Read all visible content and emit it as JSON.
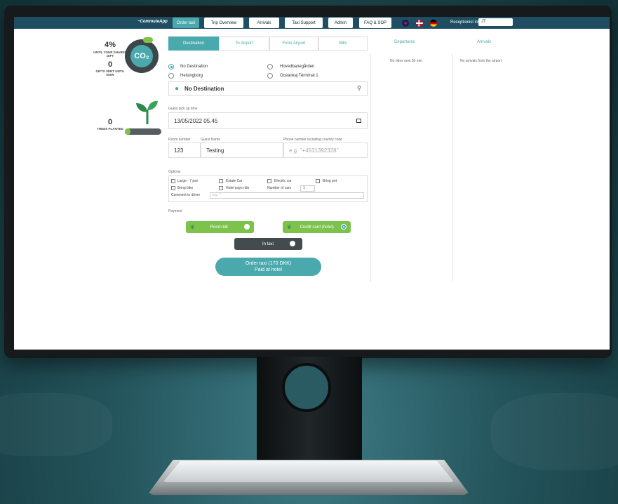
{
  "app": {
    "brand": "~CommuteApp"
  },
  "nav": {
    "tabs": [
      {
        "label": "Order taxi",
        "active": true
      },
      {
        "label": "Trip Overview"
      },
      {
        "label": "Arrivals"
      },
      {
        "label": "Taxi Support"
      },
      {
        "label": "Admin"
      },
      {
        "label": "FAQ & SOP"
      }
    ],
    "flags": [
      "uk-flag-icon",
      "denmark-flag-icon",
      "germany-flag-icon"
    ],
    "receptionist_label": "Receptionist initials",
    "receptionist_value": "JT"
  },
  "stats": {
    "shared_pct": "4%",
    "shared_label": "UNTIL YOUR SHARED GIFT",
    "gifts_count": "0",
    "gifts_label": "GIFTS SENT UNTIL NOW",
    "co2_label": "CO₂",
    "trees_count": "0",
    "trees_label": "TREES PLANTED"
  },
  "form": {
    "subtabs": [
      {
        "label": "Destination",
        "active": true
      },
      {
        "label": "To Airport"
      },
      {
        "label": "From Airport"
      },
      {
        "label": "Bills"
      }
    ],
    "destinations": [
      {
        "label": "No Destination",
        "checked": true
      },
      {
        "label": "Hovedbanegården"
      },
      {
        "label": "Helsingborg"
      },
      {
        "label": "Oceankaj Terminal 1"
      }
    ],
    "destination_value": "No Destination",
    "pickup_label": "Guest pick up time",
    "pickup_value": "13/05/2022 05.45",
    "room_label": "Room number",
    "room_value": "123",
    "guest_label": "Guest Name",
    "guest_value": "Testing",
    "phone_label": "Phone number including country code",
    "phone_placeholder": "e.g. \"+4531392328\"",
    "options_label": "Options",
    "options": [
      "Large - 7 psn",
      "Estate Car",
      "Electric car",
      "Bring pet",
      "Bring bike",
      "Hotel pays ride"
    ],
    "cars_label": "Number of cars",
    "cars_value": "1",
    "comment_label": "Comment to driver",
    "comment_placeholder": "e.g. \"",
    "payment_label": "Payment",
    "pay_room": "Room bill",
    "pay_card": "Credit card (hotel)",
    "pay_taxi": "In taxi",
    "order_line1": "Order taxi (170 DKK)",
    "order_line2": "Paid at hotel"
  },
  "departures": {
    "title": "Departures",
    "text": "No rides next 30 min"
  },
  "arrivals": {
    "title": "Arrivals",
    "text": "No arrivals from the airport"
  }
}
